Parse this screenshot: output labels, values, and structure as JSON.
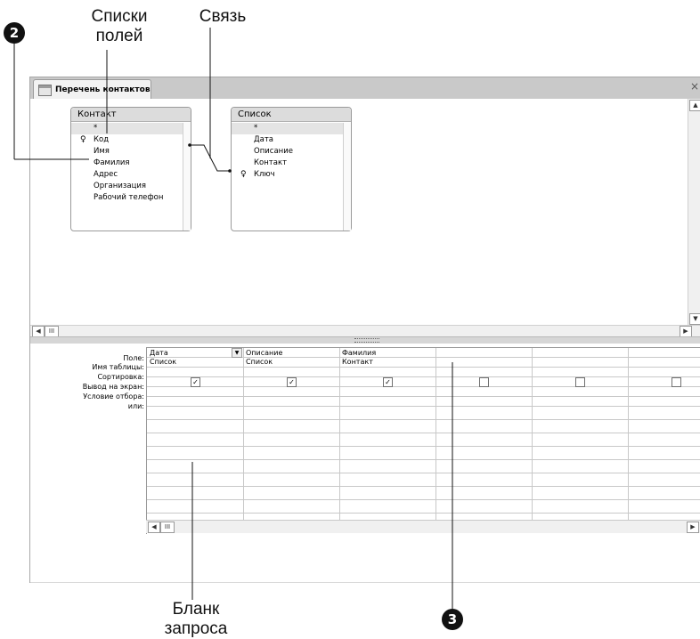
{
  "callouts": {
    "field_lists": "Списки полей",
    "relationship": "Связь",
    "query_grid": "Бланк запроса",
    "marker_2": "2",
    "marker_3": "3"
  },
  "window": {
    "tab_title": "Перечень контактов",
    "tab_icon": "query-icon",
    "close_glyph": "×"
  },
  "tables": [
    {
      "title": "Контакт",
      "fields": [
        "*",
        "Код",
        "Имя",
        "Фамилия",
        "Адрес",
        "Организация",
        "Рабочий телефон"
      ],
      "key_field": "Код"
    },
    {
      "title": "Список",
      "fields": [
        "*",
        "Дата",
        "Описание",
        "Контакт",
        "Ключ"
      ],
      "key_field": "Ключ"
    }
  ],
  "grid": {
    "row_labels": [
      "Поле:",
      "Имя таблицы:",
      "Сортировка:",
      "Вывод на экран:",
      "Условие отбора:",
      "или:"
    ],
    "columns": [
      {
        "field": "Дата",
        "table": "Список",
        "show": true,
        "dropdown": true
      },
      {
        "field": "Описание",
        "table": "Список",
        "show": true
      },
      {
        "field": "Фамилия",
        "table": "Контакт",
        "show": true
      },
      {
        "field": "",
        "table": "",
        "show": false
      },
      {
        "field": "",
        "table": "",
        "show": false
      },
      {
        "field": "",
        "table": "",
        "show": false
      }
    ],
    "check_glyph": "✓"
  },
  "scrollbar": {
    "left_arrow": "◀",
    "right_arrow": "▶",
    "up_arrow": "▲",
    "down_arrow": "▼",
    "thumb": "III"
  }
}
